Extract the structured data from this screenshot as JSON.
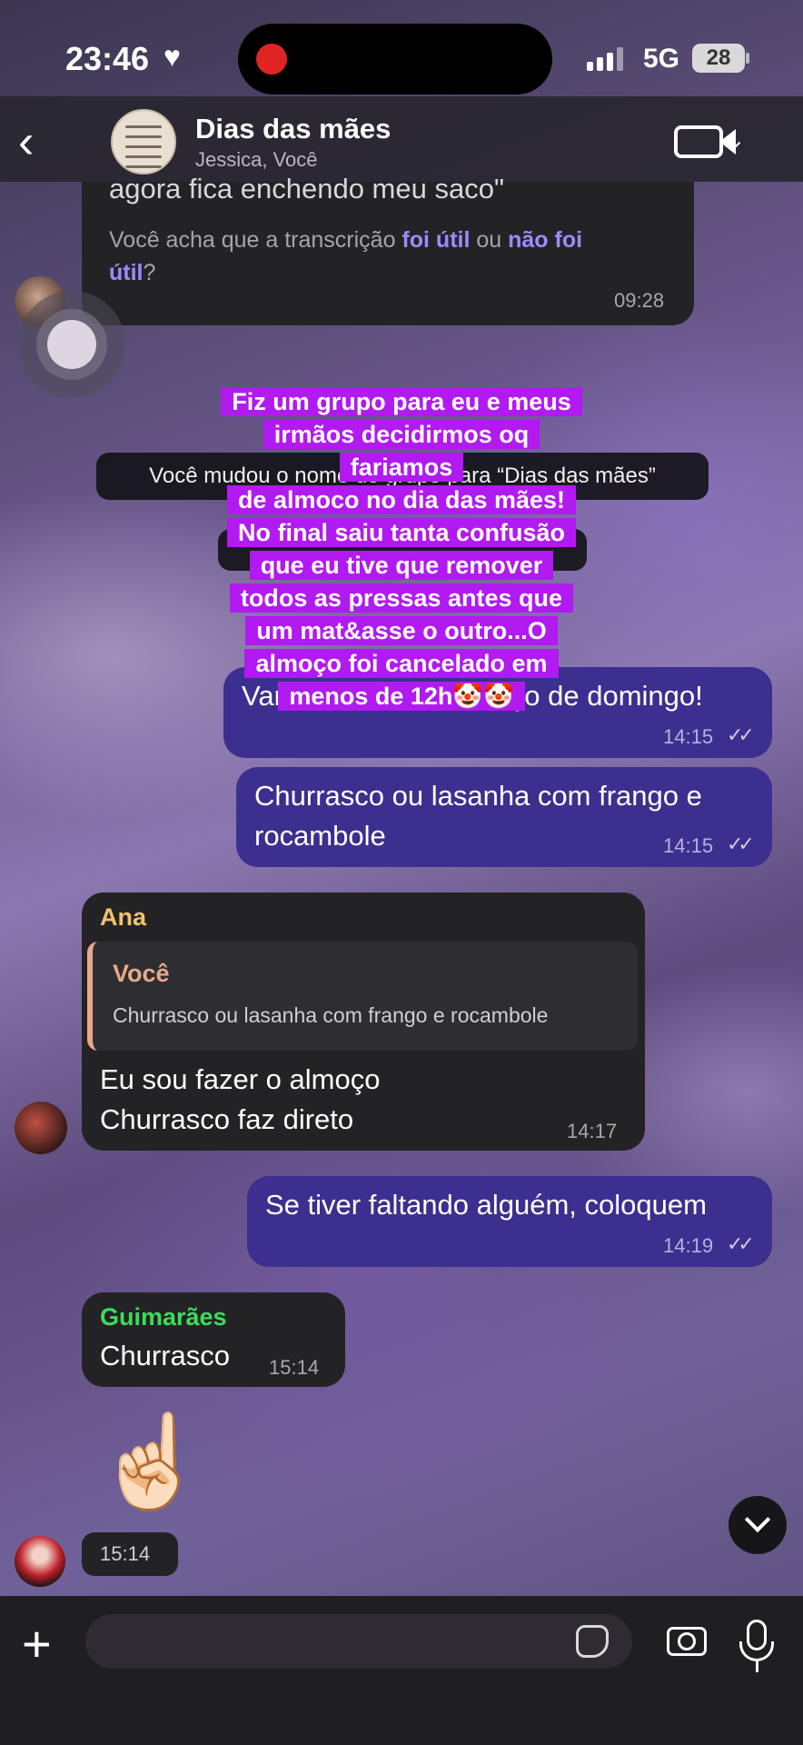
{
  "status_bar": {
    "time": "23:46",
    "heart": "♥",
    "network": "5G",
    "battery": "28"
  },
  "header": {
    "back": "‹",
    "title": "Dias das mães",
    "subtitle": "Jessica, Você",
    "video_chevron": "⌄"
  },
  "messages": {
    "transcript": {
      "text": "agora fica enchendo meu saco\"",
      "question_pre": "Você acha que a transcrição ",
      "useful": "foi útil",
      "or": " ou ",
      "not_useful_a": "não foi",
      "not_useful_b": "útil",
      "question_post": "?",
      "time": "09:28"
    },
    "system_rename": "Você mudou o nome do grupo para “Dias das mães”",
    "out1": {
      "text": "Vamos decidir o almoço de domingo!",
      "time": "14:15",
      "ticks": "✓✓"
    },
    "out2": {
      "line1": "Churrasco ou lasanha com frango e",
      "line2": "rocambole",
      "time": "14:15",
      "ticks": "✓✓"
    },
    "ana": {
      "sender": "Ana",
      "quote_sender": "Você",
      "quote_text": "Churrasco ou lasanha com frango e rocambole",
      "line1": "Eu sou fazer o almoço",
      "line2": "Churrasco faz direto",
      "time": "14:17"
    },
    "out3": {
      "text": "Se tiver faltando alguém, coloquem",
      "time": "14:19",
      "ticks": "✓✓"
    },
    "guimaraes": {
      "sender": "Guimarães",
      "text": "Churrasco",
      "time": "15:14"
    },
    "emoji_msg": {
      "emoji": "☝🏻",
      "time": "15:14"
    }
  },
  "overlay": [
    "Fiz um grupo para eu e meus",
    "irmãos decidirmos oq",
    "fariamos",
    "de almoco no dia das mães!",
    "No final saiu tanta confusão",
    "que eu tive que remover",
    "todos as pressas antes que",
    "um mat&asse o outro...O",
    "almoço  foi cancelado em",
    "menos de 12h🤡🤡"
  ],
  "input": {
    "plus": "+"
  },
  "colors": {
    "outgoing": "#3d2f8f",
    "incoming": "#232325",
    "overlay": "#b11af0",
    "link": "#9f89ff",
    "ana": "#f0c26b",
    "guimaraes": "#3ddc5a"
  }
}
